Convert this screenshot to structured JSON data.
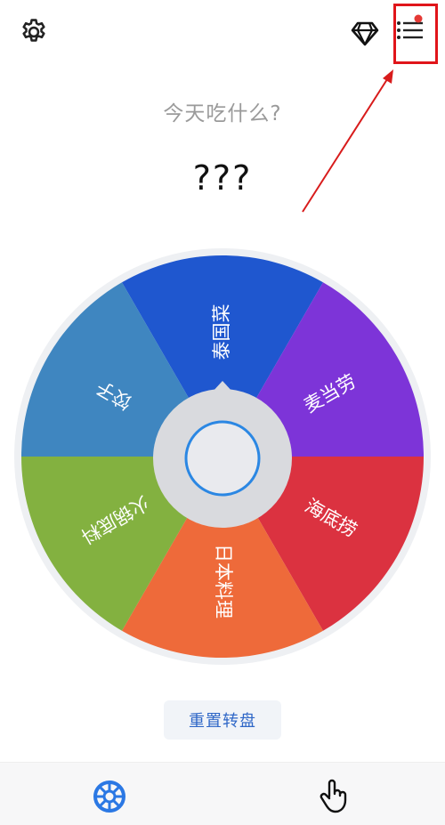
{
  "header": {
    "settings_icon": "gear-icon",
    "premium_icon": "diamond-icon",
    "list_icon": "list-icon",
    "notification_color": "#e53935"
  },
  "main": {
    "question": "今天吃什么?",
    "result": "???"
  },
  "wheel": {
    "segments": [
      {
        "label": "泰国菜",
        "color": "#1f57cf"
      },
      {
        "label": "麦当劳",
        "color": "#7d34d8"
      },
      {
        "label": "海底捞",
        "color": "#db3240"
      },
      {
        "label": "日本料理",
        "color": "#ee6a3a"
      },
      {
        "label": "火锅底料",
        "color": "#83b140"
      },
      {
        "label": "饺子",
        "color": "#3f86c0"
      }
    ]
  },
  "actions": {
    "reset_label": "重置转盘"
  },
  "bottom_nav": {
    "wheel_tab_icon": "wheel-icon",
    "hand_tab_icon": "tap-hand-icon",
    "active_color": "#2b78e4"
  }
}
